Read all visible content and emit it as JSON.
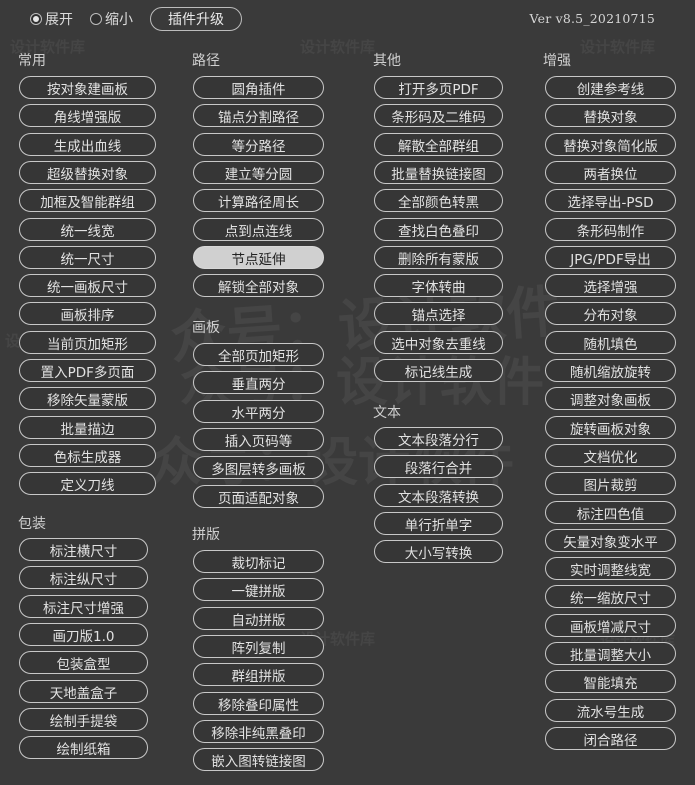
{
  "header": {
    "expand_label": "展开",
    "collapse_label": "缩小",
    "expand_selected": true,
    "upgrade_label": "插件升级",
    "version": "Ver v8.5_20210715"
  },
  "columns": {
    "common": {
      "title": "常用",
      "items": [
        "按对象建画板",
        "角线增强版",
        "生成出血线",
        "超级替换对象",
        "加框及智能群组",
        "统一线宽",
        "统一尺寸",
        "统一画板尺寸",
        "画板排序",
        "当前页加矩形",
        "置入PDF多页面",
        "移除矢量蒙版",
        "批量描边",
        "色标生成器",
        "定义刀线"
      ]
    },
    "package": {
      "title": "包装",
      "items": [
        "标注横尺寸",
        "标注纵尺寸",
        "标注尺寸增强",
        "画刀版1.0",
        "包装盒型",
        "天地盖盒子",
        "绘制手提袋",
        "绘制纸箱"
      ]
    },
    "path": {
      "title": "路径",
      "items": [
        "圆角插件",
        "锚点分割路径",
        "等分路径",
        "建立等分圆",
        "计算路径周长",
        "点到点连线",
        "节点延伸",
        "解锁全部对象"
      ],
      "active_index": 6
    },
    "artboard": {
      "title": "画板",
      "items": [
        "全部页加矩形",
        "垂直两分",
        "水平两分",
        "插入页码等",
        "多图层转多画板",
        "页面适配对象"
      ]
    },
    "imposition": {
      "title": "拼版",
      "items": [
        "裁切标记",
        "一键拼版",
        "自动拼版",
        "阵列复制",
        "群组拼版",
        "移除叠印属性",
        "移除非纯黑叠印",
        "嵌入图转链接图"
      ]
    },
    "other": {
      "title": "其他",
      "items": [
        "打开多页PDF",
        "条形码及二维码",
        "解散全部群组",
        "批量替换链接图",
        "全部颜色转黑",
        "查找白色叠印",
        "删除所有蒙版",
        "字体转曲",
        "锚点选择",
        "选中对象去重线",
        "标记线生成"
      ]
    },
    "text": {
      "title": "文本",
      "items": [
        "文本段落分行",
        "段落行合并",
        "文本段落转换",
        "单行折单字",
        "大小写转换"
      ]
    },
    "enhance": {
      "title": "增强",
      "items": [
        "创建参考线",
        "替换对象",
        "替换对象简化版",
        "两者换位",
        "选择导出-PSD",
        "条形码制作",
        "JPG/PDF导出",
        "选择增强",
        "分布对象",
        "随机填色",
        "随机缩放旋转",
        "调整对象画板",
        "旋转画板对象",
        "文档优化",
        "图片裁剪",
        "标注四色值",
        "矢量对象变水平",
        "实时调整线宽",
        "统一缩放尺寸",
        "画板增减尺寸",
        "批量调整大小",
        "智能填充",
        "流水号生成",
        "闭合路径"
      ]
    }
  },
  "watermark": {
    "big_text": "众号：设计软件",
    "small_text": "设计软件库"
  }
}
